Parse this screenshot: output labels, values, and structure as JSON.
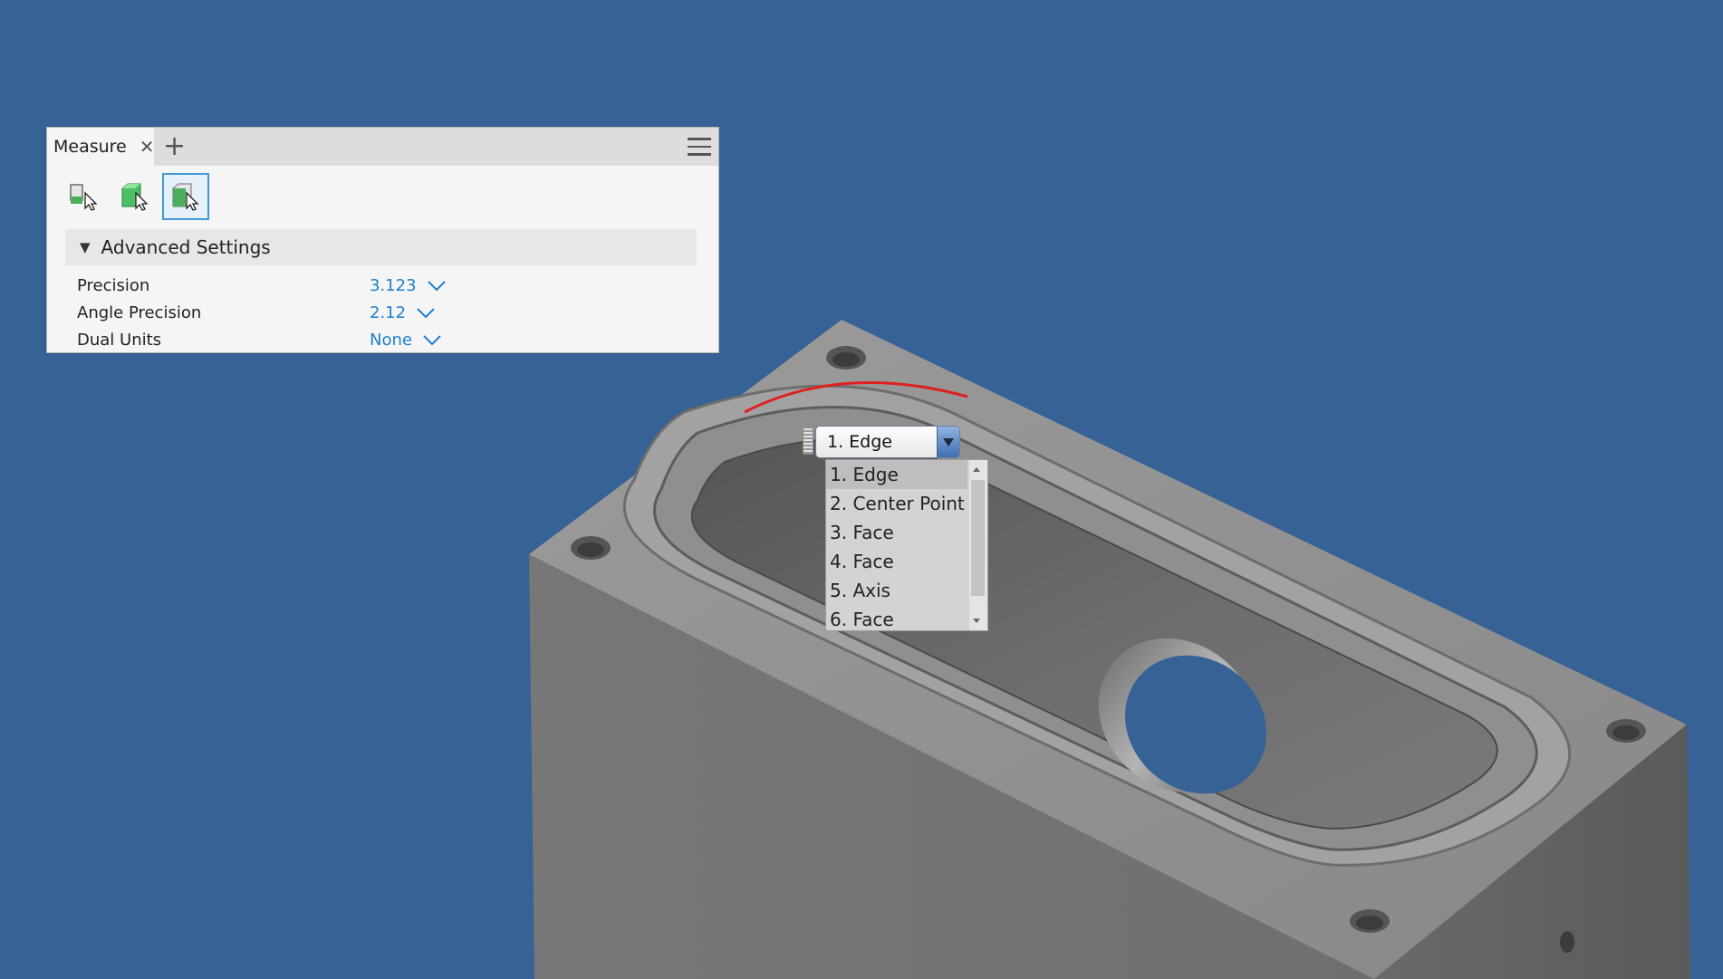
{
  "panel": {
    "tab_label": "Measure",
    "tab_close": "✕",
    "tab_add": "+",
    "tools": [
      {
        "name": "select-measure-tool"
      },
      {
        "name": "select-body-tool"
      },
      {
        "name": "select-face-tool",
        "active": true
      }
    ],
    "section_title": "Advanced Settings",
    "section_expanded": true,
    "settings": [
      {
        "label": "Precision",
        "value": "3.123"
      },
      {
        "label": "Angle Precision",
        "value": "2.12"
      },
      {
        "label": "Dual Units",
        "value": "None"
      }
    ]
  },
  "selector": {
    "current": "1. Edge",
    "options": [
      "1. Edge",
      "2. Center Point",
      "3. Face",
      "4. Face",
      "5. Axis",
      "6. Face"
    ],
    "selected_index": 0
  },
  "colors": {
    "background": "#366296",
    "accent_blue": "#1f7fcf",
    "highlight_edge": "#e02020",
    "part_gray": "#8c8c8c"
  }
}
